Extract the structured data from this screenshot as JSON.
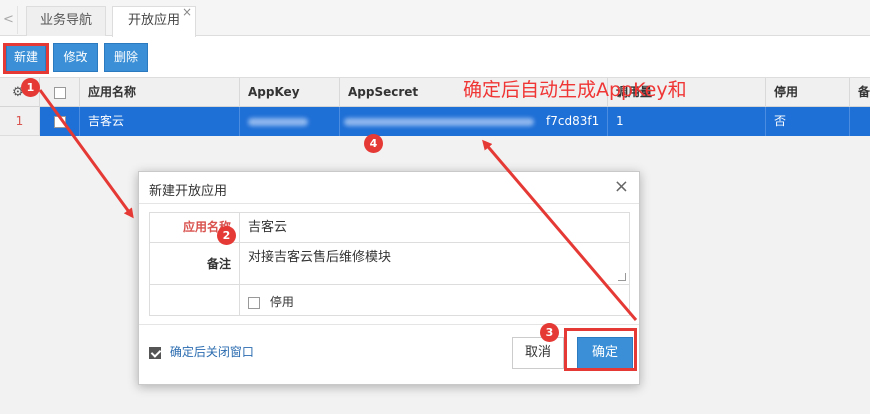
{
  "tabs": {
    "scroll_glyph": "<",
    "items": [
      {
        "label": "业务导航"
      },
      {
        "label": "开放应用",
        "close": "×"
      }
    ]
  },
  "toolbar": {
    "new_label": "新建",
    "edit_label": "修改",
    "delete_label": "删除"
  },
  "grid": {
    "columns": [
      "应用名称",
      "AppKey",
      "AppSecret",
      "调用量",
      "停用",
      "备"
    ],
    "row": {
      "number": "1",
      "name": "吉客云",
      "appsecret_tail": "f7cd83f1",
      "calls": "1",
      "disabled": "否"
    }
  },
  "annotation": {
    "text": "确定后自动生成AppKey和",
    "badges": [
      "1",
      "2",
      "3",
      "4"
    ],
    "color": "#e53935"
  },
  "dialog": {
    "title": "新建开放应用",
    "close": "×",
    "fields": {
      "name_label": "应用名称",
      "name_value": "吉客云",
      "remark_label": "备注",
      "remark_value": "对接吉客云售后维修模块",
      "disabled_label": "停用"
    },
    "close_after_confirm": "确定后关闭窗口",
    "cancel_label": "取消",
    "ok_label": "确定"
  },
  "colors": {
    "accent": "#3a8fd6",
    "selected_row": "#1e6fd6",
    "annotation_red": "#e53935"
  }
}
